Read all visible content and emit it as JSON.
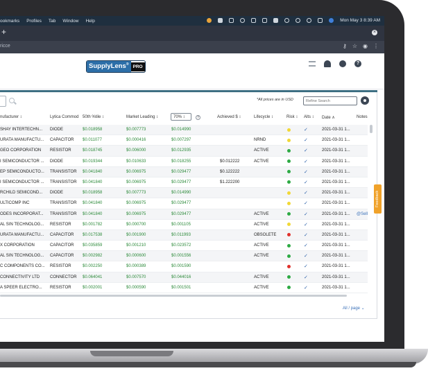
{
  "menubar": {
    "menus": [
      "ookmarks",
      "Profiles",
      "Tab",
      "Window",
      "Help"
    ],
    "clock": "Mon May 3  8:39 AM"
  },
  "browser": {
    "new_tab": "+",
    "url": "ricce"
  },
  "header": {
    "logo_main": "SupplyLens",
    "logo_sup": "®",
    "logo_badge": "PRO",
    "help": "?"
  },
  "toolbar": {
    "price_note": "*All prices are in USD",
    "search_placeholder": "Refine Search"
  },
  "table": {
    "columns": {
      "manufacturer": "nufacturer ↕",
      "lytica": "Lytica Commod",
      "p50": "50th %tile ↕",
      "market": "Market Leading ↕",
      "pct_select": "70% ↕",
      "pct_help": "?",
      "achieved": "Achieved $ ↕",
      "lifecycle": "Lifecycle ↕",
      "risk": "Risk ↕",
      "alts": "Alts ↕",
      "date": "Date ∧",
      "notes": "Notes"
    },
    "rows": [
      {
        "mfr": "SHAY INTERTECHN...",
        "commod": "DIODE",
        "p50": "$0.018958",
        "market": "$0.007773",
        "p70": "$0.014990",
        "achieved": "",
        "life": "",
        "risk": "#f1d836",
        "date": "2021-03-31 1...",
        "notes": ""
      },
      {
        "mfr": "URATA MANUFACTU...",
        "commod": "CAPACITOR",
        "p50": "$0.011077",
        "market": "$0.000416",
        "p70": "$0.007297",
        "achieved": "",
        "life": "NRND",
        "risk": "#f1d836",
        "date": "2021-03-31 1...",
        "notes": ""
      },
      {
        "mfr": "GEO CORPORATION",
        "commod": "RESISTOR",
        "p50": "$0.018745",
        "market": "$0.006000",
        "p70": "$0.012935",
        "achieved": "",
        "life": "ACTIVE",
        "risk": "#2eaa44",
        "date": "2021-03-31 1...",
        "notes": ""
      },
      {
        "mfr": "I SEMICONDUCTOR ...",
        "commod": "DIODE",
        "p50": "$0.019344",
        "market": "$0.010633",
        "p70": "$0.018255",
        "achieved": "$0.012222",
        "life": "ACTIVE",
        "risk": "#2eaa44",
        "date": "2021-03-31 1...",
        "notes": ""
      },
      {
        "mfr": "EP SEMICONDUCTO...",
        "commod": "TRANSISTOR",
        "p50": "$0.041840",
        "market": "$0.006975",
        "p70": "$0.029477",
        "achieved": "$0.122222",
        "life": "",
        "risk": "#2eaa44",
        "date": "2021-03-31 1...",
        "notes": ""
      },
      {
        "mfr": "I SEMICONDUCTOR ...",
        "commod": "TRANSISTOR",
        "p50": "$0.041840",
        "market": "$0.006975",
        "p70": "$0.029477",
        "achieved": "$1.222200",
        "life": "",
        "risk": "#2eaa44",
        "date": "2021-03-31 1...",
        "notes": ""
      },
      {
        "mfr": "RCHILD SEMICOND...",
        "commod": "DIODE",
        "p50": "$0.018958",
        "market": "$0.007773",
        "p70": "$0.014990",
        "achieved": "",
        "life": "",
        "risk": "#f1d836",
        "date": "2021-03-31 1...",
        "notes": ""
      },
      {
        "mfr": "ULTICOMP INC",
        "commod": "TRANSISTOR",
        "p50": "$0.041840",
        "market": "$0.006975",
        "p70": "$0.029477",
        "achieved": "",
        "life": "",
        "risk": "#f1d836",
        "date": "2021-03-31 1...",
        "notes": ""
      },
      {
        "mfr": "ODES INCORPORAT...",
        "commod": "TRANSISTOR",
        "p50": "$0.041840",
        "market": "$0.006975",
        "p70": "$0.029477",
        "achieved": "",
        "life": "ACTIVE",
        "risk": "#2eaa44",
        "date": "2021-03-31 1...",
        "notes": "@Sell"
      },
      {
        "mfr": "AL SIN TECHNOLOG...",
        "commod": "RESISTOR",
        "p50": "$0.001782",
        "market": "$0.000700",
        "p70": "$0.001105",
        "achieved": "",
        "life": "ACTIVE",
        "risk": "#f1d836",
        "date": "2021-03-31 1...",
        "notes": ""
      },
      {
        "mfr": "URATA MANUFACTU...",
        "commod": "CAPACITOR",
        "p50": "$0.017538",
        "market": "$0.001900",
        "p70": "$0.011993",
        "achieved": "",
        "life": "OBSOLETE",
        "risk": "#e0312c",
        "date": "2021-03-31 1...",
        "notes": ""
      },
      {
        "mfr": "X CORPORATION",
        "commod": "CAPACITOR",
        "p50": "$0.035859",
        "market": "$0.001210",
        "p70": "$0.023572",
        "achieved": "",
        "life": "ACTIVE",
        "risk": "#2eaa44",
        "date": "2021-03-31 1...",
        "notes": ""
      },
      {
        "mfr": "AL SIN TECHNOLOG...",
        "commod": "CAPACITOR",
        "p50": "$0.002982",
        "market": "$0.000600",
        "p70": "$0.001556",
        "achieved": "",
        "life": "ACTIVE",
        "risk": "#2eaa44",
        "date": "2021-03-31 1...",
        "notes": ""
      },
      {
        "mfr": "C COMPONENTS CO...",
        "commod": "RESISTOR",
        "p50": "$0.002250",
        "market": "$0.000389",
        "p70": "$0.001590",
        "achieved": "",
        "life": "",
        "risk": "#e0312c",
        "date": "2021-03-31 1...",
        "notes": ""
      },
      {
        "mfr": "CONNECTIVITY LTD",
        "commod": "CONNECTOR",
        "p50": "$0.064041",
        "market": "$0.007570",
        "p70": "$0.044016",
        "achieved": "",
        "life": "ACTIVE",
        "risk": "#2eaa44",
        "date": "2021-03-31 1...",
        "notes": ""
      },
      {
        "mfr": "A SPEER ELECTRO...",
        "commod": "RESISTOR",
        "p50": "$0.002001",
        "market": "$0.000590",
        "p70": "$0.001501",
        "achieved": "",
        "life": "ACTIVE",
        "risk": "#2eaa44",
        "date": "2021-03-31 1...",
        "notes": ""
      }
    ]
  },
  "footer": {
    "per_page": "All / page ⌄"
  },
  "feedback_tab": "Feedback",
  "colors": {
    "brand_blue": "#2d6fa8",
    "price_green": "#2c8a3a",
    "risk_green": "#2eaa44",
    "risk_yellow": "#f1d836",
    "risk_red": "#e0312c",
    "feedback_orange": "#f0a22a"
  }
}
